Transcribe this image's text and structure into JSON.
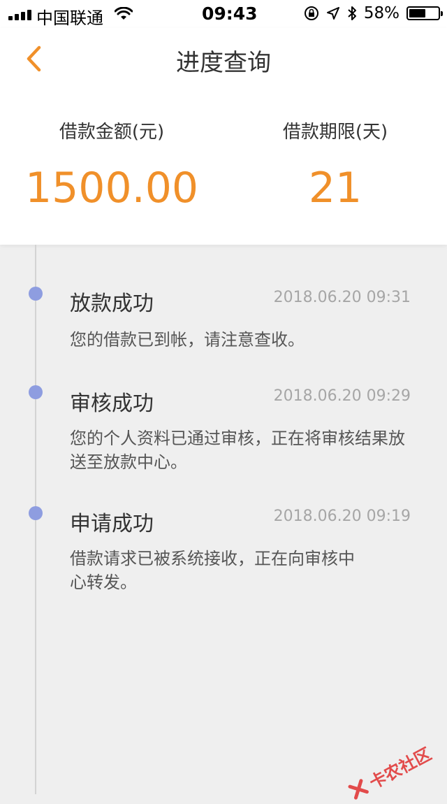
{
  "status_bar": {
    "carrier": "中国联通",
    "time": "09:43",
    "battery_percent": "58%",
    "battery_level": 0.58,
    "icons": [
      "signal-icon",
      "wifi-icon",
      "lock-rotation-icon",
      "location-icon",
      "bluetooth-icon",
      "battery-icon"
    ]
  },
  "header": {
    "title": "进度查询",
    "back_icon": "chevron-left-icon"
  },
  "summary": {
    "amount_label": "借款金额(元)",
    "amount_value": "1500.00",
    "term_label": "借款期限(天)",
    "term_value": "21"
  },
  "timeline": [
    {
      "title": "放款成功",
      "time": "2018.06.20 09:31",
      "desc": "您的借款已到帐，请注意查收。"
    },
    {
      "title": "审核成功",
      "time": "2018.06.20 09:29",
      "desc": "您的个人资料已通过审核，正在将审核结果放送至放款中心。"
    },
    {
      "title": "申请成功",
      "time": "2018.06.20 09:19",
      "desc": "借款请求已被系统接收，正在向审核中心转发。"
    }
  ],
  "watermark": {
    "text": "卡农社区"
  },
  "colors": {
    "accent": "#f0902a",
    "timeline_dot": "#8e9de0",
    "background": "#efefef"
  }
}
